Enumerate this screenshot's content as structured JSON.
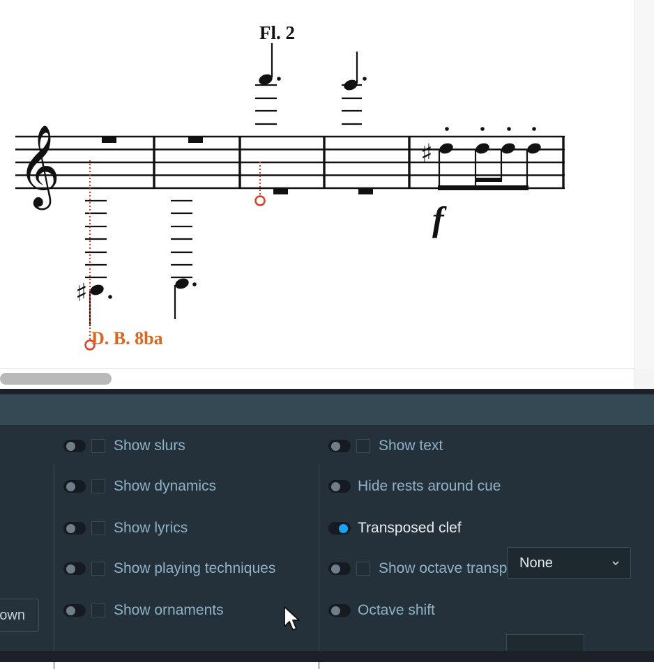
{
  "score": {
    "staff_label": "Fl. 2",
    "octave_marking": "D. B. 8ba",
    "dynamic": "f",
    "accent_color": "#e0651a",
    "line_color": "#e2381e"
  },
  "panel": {
    "left_button_label": "own",
    "col1": [
      {
        "label": "Show slurs",
        "on": false
      },
      {
        "label": "Show dynamics",
        "on": false
      },
      {
        "label": "Show lyrics",
        "on": false
      },
      {
        "label": "Show playing techniques",
        "on": false
      },
      {
        "label": "Show ornaments",
        "on": false
      }
    ],
    "col2": {
      "show_text": "Show text",
      "hide_rests": "Hide rests around cue",
      "transposed_clef": "Transposed clef",
      "transposed_clef_value": "None",
      "show_octave": "Show octave transposition",
      "octave_shift": "Octave shift",
      "octave_shift_value": ""
    },
    "colors": {
      "toggle_on": "#1aa3f2",
      "label": "#8fb3c6",
      "label_active": "#e9edf0",
      "header": "#344954",
      "body": "#24303a"
    }
  }
}
